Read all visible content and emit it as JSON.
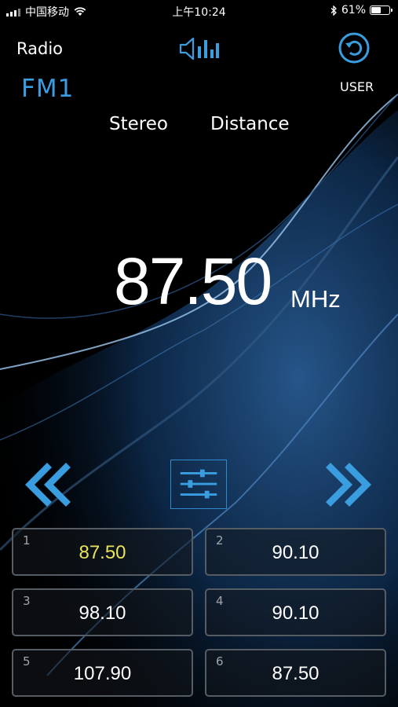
{
  "status_bar": {
    "carrier": "中国移动",
    "time": "上午10:24",
    "battery": "61%",
    "battery_level": 0.61
  },
  "header": {
    "title": "Radio",
    "band": "FM1",
    "user_label": "USER"
  },
  "modes": {
    "stereo": "Stereo",
    "distance": "Distance"
  },
  "tuner": {
    "frequency": "87.50",
    "unit": "MHz"
  },
  "presets": [
    {
      "num": "1",
      "value": "87.50",
      "active": true
    },
    {
      "num": "2",
      "value": "90.10",
      "active": false
    },
    {
      "num": "3",
      "value": "98.10",
      "active": false
    },
    {
      "num": "4",
      "value": "90.10",
      "active": false
    },
    {
      "num": "5",
      "value": "107.90",
      "active": false
    },
    {
      "num": "6",
      "value": "87.50",
      "active": false
    }
  ],
  "colors": {
    "accent": "#3a9de0",
    "active_preset": "#e8e35a",
    "preset_border": "#565c64"
  }
}
